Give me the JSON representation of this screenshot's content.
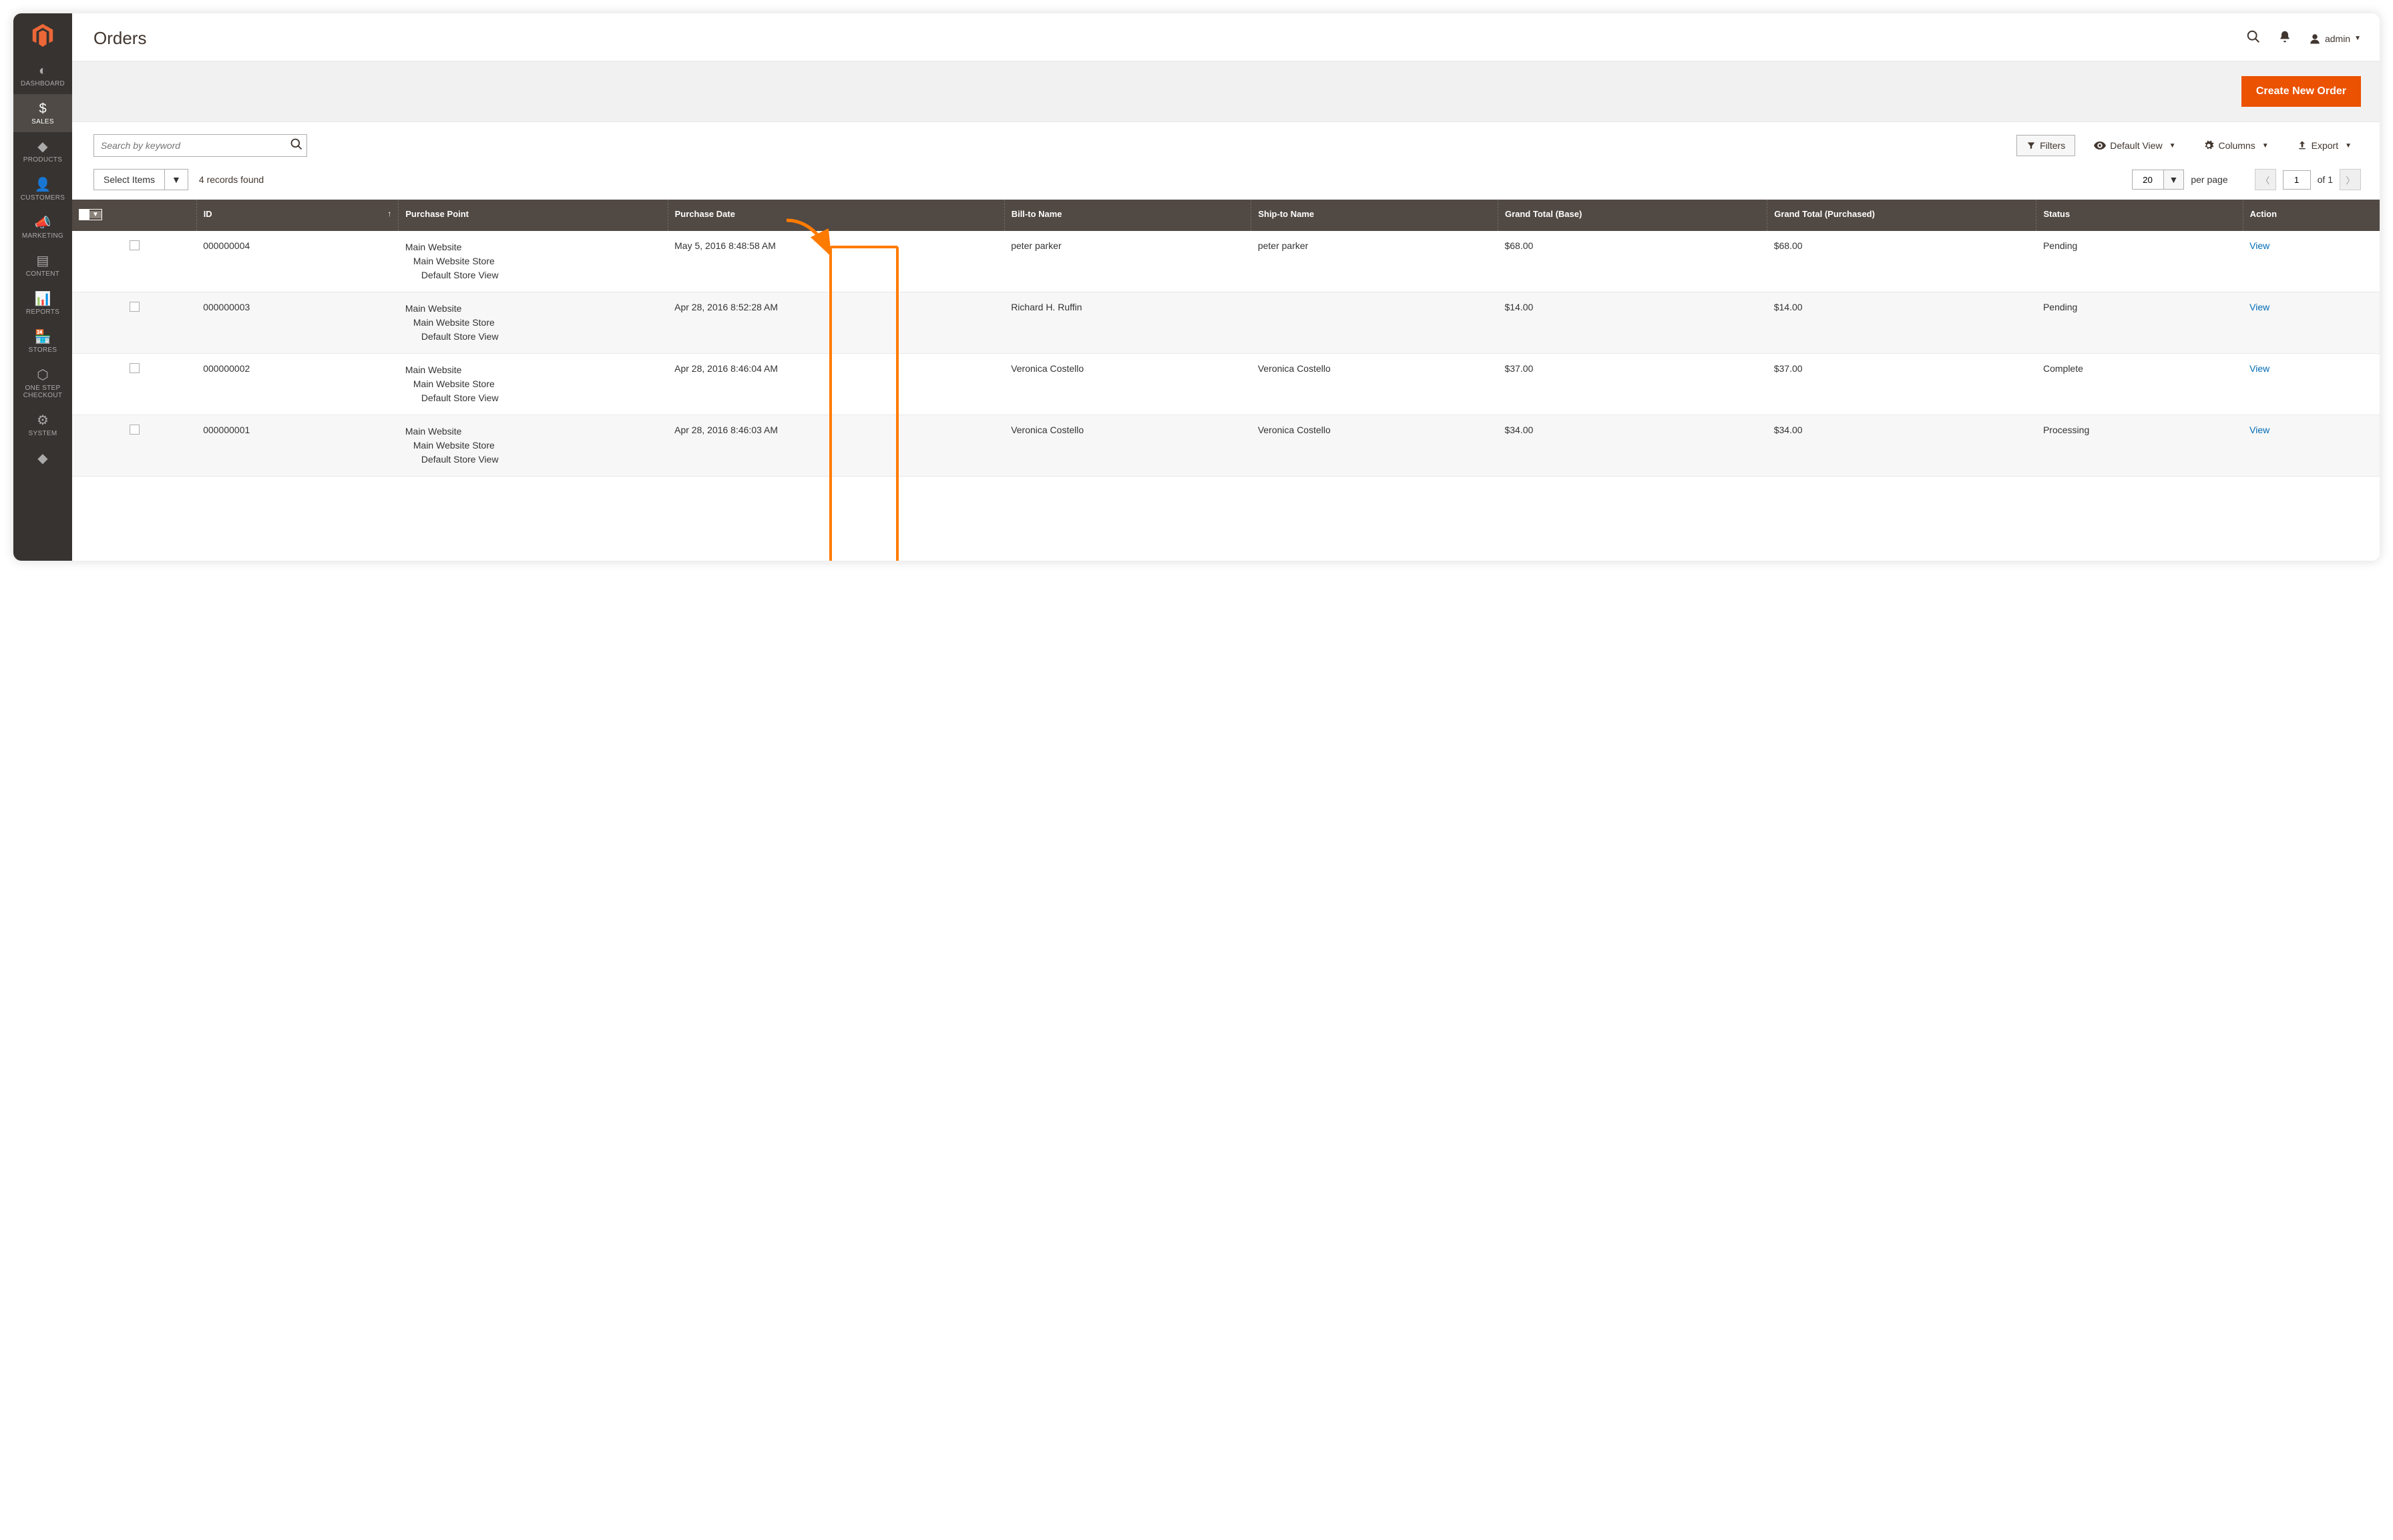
{
  "sidebar": {
    "items": [
      {
        "icon": "◐",
        "label": "DASHBOARD"
      },
      {
        "icon": "$",
        "label": "SALES",
        "active": true
      },
      {
        "icon": "◆",
        "label": "PRODUCTS"
      },
      {
        "icon": "👤",
        "label": "CUSTOMERS"
      },
      {
        "icon": "📣",
        "label": "MARKETING"
      },
      {
        "icon": "▤",
        "label": "CONTENT"
      },
      {
        "icon": "📊",
        "label": "REPORTS"
      },
      {
        "icon": "🏪",
        "label": "STORES"
      },
      {
        "icon": "⬡",
        "label": "ONE STEP CHECKOUT"
      },
      {
        "icon": "⚙",
        "label": "SYSTEM"
      },
      {
        "icon": "◆",
        "label": ""
      }
    ]
  },
  "header": {
    "title": "Orders",
    "user": "admin"
  },
  "actions": {
    "create": "Create New Order"
  },
  "toolbar": {
    "search_placeholder": "Search by keyword",
    "filters": "Filters",
    "default_view": "Default View",
    "columns": "Columns",
    "export": "Export"
  },
  "toolbar2": {
    "select_items": "Select Items",
    "records_found": "4 records found",
    "page_size": "20",
    "per_page": "per page",
    "page": "1",
    "of": "of 1"
  },
  "columns": {
    "id": "ID",
    "purchase_point": "Purchase Point",
    "purchase_date": "Purchase Date",
    "bill_to": "Bill-to Name",
    "ship_to": "Ship-to Name",
    "gt_base": "Grand Total (Base)",
    "gt_purchased": "Grand Total (Purchased)",
    "status": "Status",
    "action": "Action"
  },
  "purchase_point": {
    "l1": "Main Website",
    "l2": "Main Website Store",
    "l3": "Default Store View"
  },
  "rows": [
    {
      "id": "000000004",
      "date": "May 5, 2016 8:48:58 AM",
      "bill": "peter parker",
      "ship": "peter parker",
      "base": "$68.00",
      "purchased": "$68.00",
      "status": "Pending",
      "action": "View"
    },
    {
      "id": "000000003",
      "date": "Apr 28, 2016 8:52:28 AM",
      "bill": "Richard H. Ruffin",
      "ship": "",
      "base": "$14.00",
      "purchased": "$14.00",
      "status": "Pending",
      "action": "View"
    },
    {
      "id": "000000002",
      "date": "Apr 28, 2016 8:46:04 AM",
      "bill": "Veronica Costello",
      "ship": "Veronica Costello",
      "base": "$37.00",
      "purchased": "$37.00",
      "status": "Complete",
      "action": "View"
    },
    {
      "id": "000000001",
      "date": "Apr 28, 2016 8:46:03 AM",
      "bill": "Veronica Costello",
      "ship": "Veronica Costello",
      "base": "$34.00",
      "purchased": "$34.00",
      "status": "Processing",
      "action": "View"
    }
  ]
}
